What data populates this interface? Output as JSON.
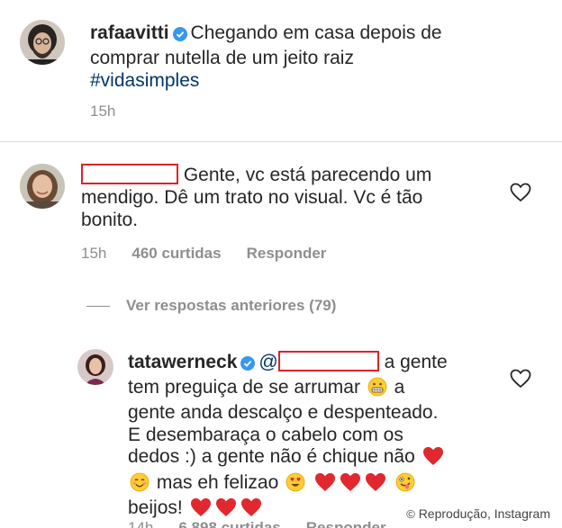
{
  "post": {
    "username": "rafaavitti",
    "caption_line1": "Chegando em casa depois de",
    "caption_line2": "comprar nutella de um jeito raiz",
    "hashtag": "#vidasimples",
    "time": "15h"
  },
  "comment1": {
    "text_line1": "Gente, vc está parecendo um",
    "text_line2": "mendigo. Dê um trato no visual. Vc é tão",
    "text_line3": "bonito.",
    "time": "15h",
    "likes": "460 curtidas",
    "reply_label": "Responder"
  },
  "view_replies": "Ver respostas anteriores (79)",
  "reply": {
    "username": "tatawerneck",
    "line1_tail": "a gente",
    "line2": "tem preguiça de se arrumar",
    "line2_tail": "a",
    "line3": "gente anda descalço e despenteado.",
    "line4": "E desembaraça o cabelo com os",
    "line5": "dedos :) a gente não é chique não",
    "line6": "mas eh felizao",
    "line7": "beijos!",
    "time": "14h",
    "likes": "6.898 curtidas",
    "reply_label": "Responder"
  },
  "credit": "Reprodução, Instagram",
  "colors": {
    "redaction": "#d9242b",
    "heart": "#e0282e",
    "verified": "#3897f0",
    "hashtag": "#003569"
  }
}
